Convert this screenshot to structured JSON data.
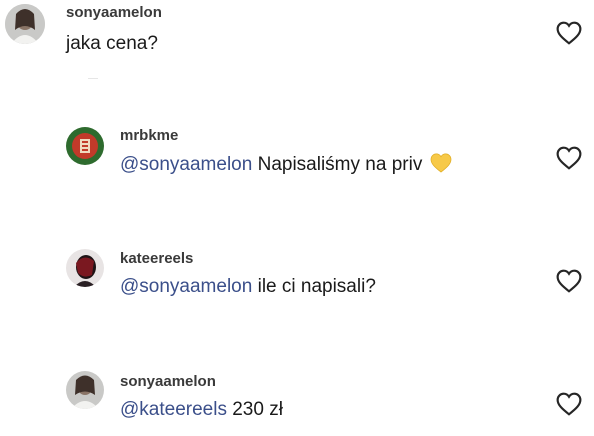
{
  "colors": {
    "mention": "#3b4f8a",
    "username": "#3a3a3a",
    "text": "#1a1a1a",
    "heart_outline": "#262626",
    "emoji_heart": "#f7c948"
  },
  "comments": [
    {
      "username": "sonyaamelon",
      "mention": "",
      "text": "jaka cena?",
      "like_icon": "heart-outline-icon"
    },
    {
      "username": "mrbkme",
      "mention": "@sonyaamelon",
      "text": "Napisaliśmy na priv",
      "emoji": "yellow-heart-emoji",
      "like_icon": "heart-outline-icon"
    },
    {
      "username": "kateereels",
      "mention": "@sonyaamelon",
      "text": "ile ci napisali?",
      "like_icon": "heart-outline-icon"
    },
    {
      "username": "sonyaamelon",
      "mention": "@kateereels",
      "text": "230 zł",
      "like_icon": "heart-outline-icon"
    }
  ]
}
